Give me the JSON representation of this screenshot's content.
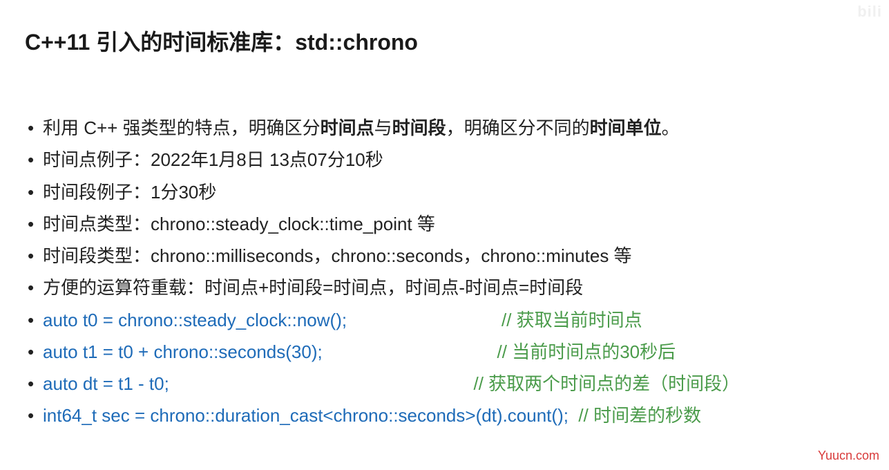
{
  "title_parts": {
    "p1": "C++11 引入的时间标准库：std::chrono"
  },
  "bullets": {
    "b1_a": "利用 C++ 强类型的特点，明确区分",
    "b1_bold1": "时间点",
    "b1_b": "与",
    "b1_bold2": "时间段",
    "b1_c": "，明确区分不同的",
    "b1_bold3": "时间单位",
    "b1_d": "。",
    "b2": "时间点例子：2022年1月8日 13点07分10秒",
    "b3": "时间段例子：1分30秒",
    "b4": "时间点类型：chrono::steady_clock::time_point 等",
    "b5": "时间段类型：chrono::milliseconds，chrono::seconds，chrono::minutes 等",
    "b6": "方便的运算符重载：时间点+时间段=时间点，时间点-时间点=时间段"
  },
  "code": {
    "l1_code": "auto t0 = chrono::steady_clock::now();                               ",
    "l1_comment": "// 获取当前时间点",
    "l2_code": "auto t1 = t0 + chrono::seconds(30);                                   ",
    "l2_comment": "// 当前时间点的30秒后",
    "l3_code": "auto dt = t1 - t0;                                                             ",
    "l3_comment": "// 获取两个时间点的差（时间段）",
    "l4_code": "int64_t sec = chrono::duration_cast<chrono::seconds>(dt).count();  ",
    "l4_comment": "// 时间差的秒数"
  },
  "watermark": "Yuucn.com",
  "faint_logo": "bili"
}
